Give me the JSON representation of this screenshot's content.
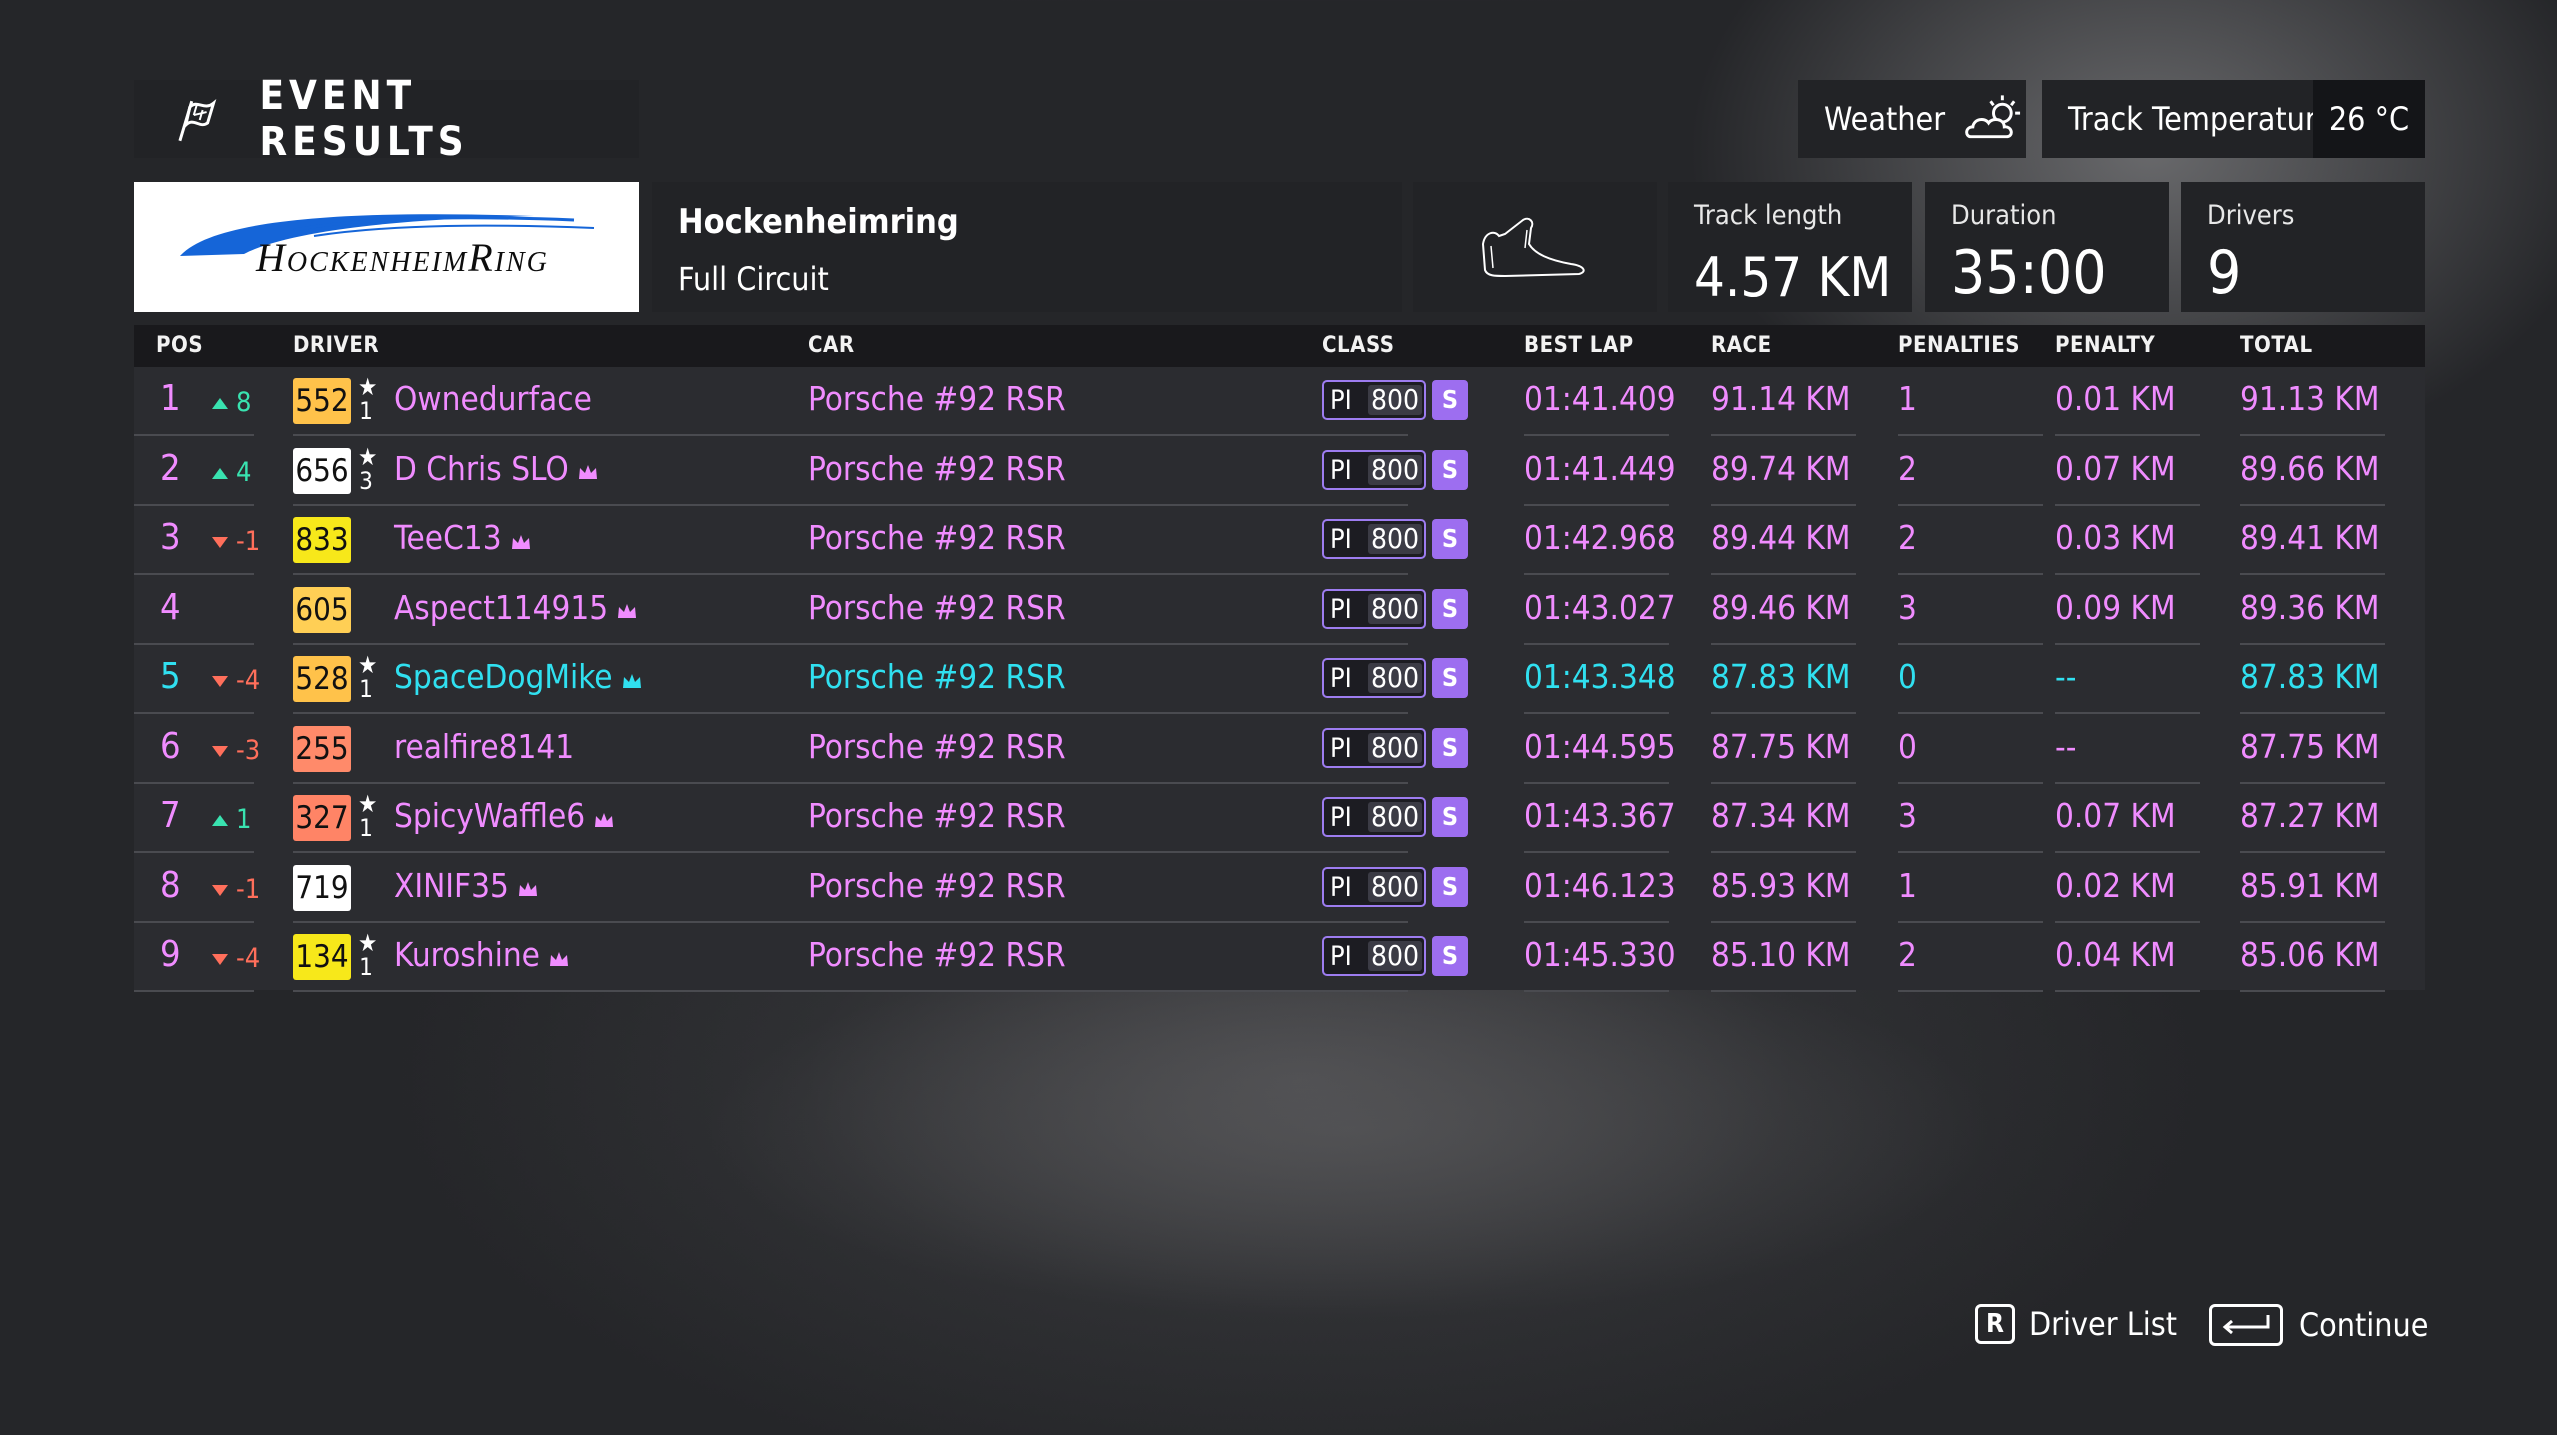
{
  "header": {
    "title": "EVENT RESULTS",
    "weather_label": "Weather",
    "weather_icon": "partly-cloudy-icon",
    "track_temp_label": "Track Temperature",
    "track_temp_value": "26 °C"
  },
  "track": {
    "logo_text": "HockenheimRing",
    "name": "Hockenheimring",
    "layout": "Full Circuit",
    "length_label": "Track length",
    "length_value": "4.57 KM",
    "duration_label": "Duration",
    "duration_value": "35:00",
    "drivers_label": "Drivers",
    "drivers_value": "9"
  },
  "columns": {
    "pos": "POS",
    "driver": "DRIVER",
    "car": "CAR",
    "class": "CLASS",
    "best_lap": "BEST LAP",
    "race": "RACE",
    "penalties": "PENALTIES",
    "penalty": "PENALTY",
    "total": "TOTAL"
  },
  "colors": {
    "highlight": "#f08cff",
    "self": "#30e0f0",
    "text": "#ffffff",
    "up": "#39e3b0",
    "down": "#ff6f5b",
    "pi_accent": "#9d6ef0"
  },
  "rows": [
    {
      "pos": "1",
      "change": "8",
      "dir": "up",
      "rating": "552",
      "rating_color": "#ffc24a",
      "rank": "1",
      "driver": "Ownedurface",
      "crown": false,
      "car": "Porsche #92 RSR",
      "pi": "PI",
      "pi_value": "800",
      "class": "S",
      "best_lap": "01:41.409",
      "race": "91.14 KM",
      "penalties": "1",
      "penalty": "0.01 KM",
      "total": "91.13 KM",
      "color": "#f08cff",
      "pos_color": "#f08cff"
    },
    {
      "pos": "2",
      "change": "4",
      "dir": "up",
      "rating": "656",
      "rating_color": "#ffffff",
      "rank": "3",
      "driver": "D Chris SLO",
      "crown": true,
      "car": "Porsche #92 RSR",
      "pi": "PI",
      "pi_value": "800",
      "class": "S",
      "best_lap": "01:41.449",
      "race": "89.74 KM",
      "penalties": "2",
      "penalty": "0.07 KM",
      "total": "89.66 KM",
      "color": "#f08cff",
      "pos_color": "#f08cff"
    },
    {
      "pos": "3",
      "change": "-1",
      "dir": "down",
      "rating": "833",
      "rating_color": "#f7e81a",
      "rank": "",
      "driver": "TeeC13",
      "crown": true,
      "car": "Porsche #92 RSR",
      "pi": "PI",
      "pi_value": "800",
      "class": "S",
      "best_lap": "01:42.968",
      "race": "89.44 KM",
      "penalties": "2",
      "penalty": "0.03 KM",
      "total": "89.41 KM",
      "color": "#f08cff",
      "pos_color": "#f08cff"
    },
    {
      "pos": "4",
      "change": "",
      "dir": "",
      "rating": "605",
      "rating_color": "#ffcf55",
      "rank": "",
      "driver": "Aspect114915",
      "crown": true,
      "car": "Porsche #92 RSR",
      "pi": "PI",
      "pi_value": "800",
      "class": "S",
      "best_lap": "01:43.027",
      "race": "89.46 KM",
      "penalties": "3",
      "penalty": "0.09 KM",
      "total": "89.36 KM",
      "color": "#f08cff",
      "pos_color": "#f08cff"
    },
    {
      "pos": "5",
      "change": "-4",
      "dir": "down",
      "rating": "528",
      "rating_color": "#ffc24a",
      "rank": "1",
      "driver": "SpaceDogMike",
      "crown": true,
      "car": "Porsche #92 RSR",
      "pi": "PI",
      "pi_value": "800",
      "class": "S",
      "best_lap": "01:43.348",
      "race": "87.83 KM",
      "penalties": "0",
      "penalty": "--",
      "total": "87.83 KM",
      "color": "#30e0f0",
      "pos_color": "#30e0f0"
    },
    {
      "pos": "6",
      "change": "-3",
      "dir": "down",
      "rating": "255",
      "rating_color": "#ff8a6a",
      "rank": "",
      "driver": "realfire8141",
      "crown": false,
      "car": "Porsche #92 RSR",
      "pi": "PI",
      "pi_value": "800",
      "class": "S",
      "best_lap": "01:44.595",
      "race": "87.75 KM",
      "penalties": "0",
      "penalty": "--",
      "total": "87.75 KM",
      "color": "#f08cff",
      "pos_color": "#f08cff"
    },
    {
      "pos": "7",
      "change": "1",
      "dir": "up",
      "rating": "327",
      "rating_color": "#ff8466",
      "rank": "1",
      "driver": "SpicyWaffle6",
      "crown": true,
      "car": "Porsche #92 RSR",
      "pi": "PI",
      "pi_value": "800",
      "class": "S",
      "best_lap": "01:43.367",
      "race": "87.34 KM",
      "penalties": "3",
      "penalty": "0.07 KM",
      "total": "87.27 KM",
      "color": "#f08cff",
      "pos_color": "#f08cff"
    },
    {
      "pos": "8",
      "change": "-1",
      "dir": "down",
      "rating": "719",
      "rating_color": "#ffffff",
      "rank": "",
      "driver": "XINIF35",
      "crown": true,
      "car": "Porsche #92 RSR",
      "pi": "PI",
      "pi_value": "800",
      "class": "S",
      "best_lap": "01:46.123",
      "race": "85.93 KM",
      "penalties": "1",
      "penalty": "0.02 KM",
      "total": "85.91 KM",
      "color": "#f08cff",
      "pos_color": "#f08cff"
    },
    {
      "pos": "9",
      "change": "-4",
      "dir": "down",
      "rating": "134",
      "rating_color": "#f7e81a",
      "rank": "1",
      "driver": "Kuroshine",
      "crown": true,
      "car": "Porsche #92 RSR",
      "pi": "PI",
      "pi_value": "800",
      "class": "S",
      "best_lap": "01:45.330",
      "race": "85.10 KM",
      "penalties": "2",
      "penalty": "0.04 KM",
      "total": "85.06 KM",
      "color": "#f08cff",
      "pos_color": "#f08cff"
    }
  ],
  "footer": {
    "driver_list_key": "R",
    "driver_list_label": "Driver List",
    "continue_label": "Continue"
  }
}
